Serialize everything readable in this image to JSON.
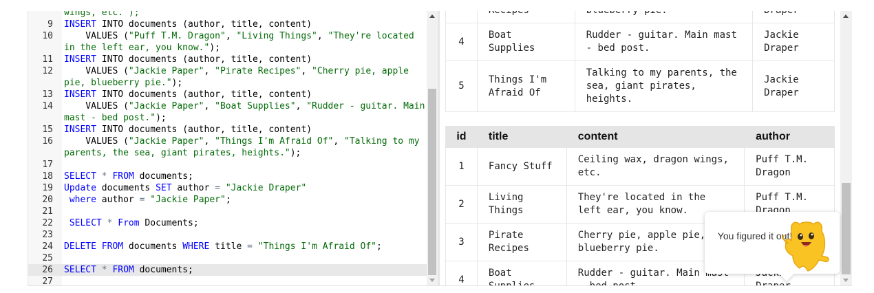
{
  "editor": {
    "lines": [
      {
        "num": "",
        "tokens": [
          {
            "t": "wings, etc.\");",
            "c": "str"
          }
        ]
      },
      {
        "num": "9",
        "tokens": [
          {
            "t": "INSERT",
            "c": "kw"
          },
          {
            "t": " INTO documents (author, title, content)"
          }
        ]
      },
      {
        "num": "10",
        "tokens": [
          {
            "t": "    VALUES ("
          },
          {
            "t": "\"Puff T.M. Dragon\"",
            "c": "str"
          },
          {
            "t": ", "
          },
          {
            "t": "\"Living Things\"",
            "c": "str"
          },
          {
            "t": ", "
          },
          {
            "t": "\"They're located",
            "c": "str"
          }
        ]
      },
      {
        "num": "",
        "tokens": [
          {
            "t": "in the left ear, you know.\"",
            "c": "str"
          },
          {
            "t": ");"
          }
        ]
      },
      {
        "num": "11",
        "tokens": [
          {
            "t": "INSERT",
            "c": "kw"
          },
          {
            "t": " INTO documents (author, title, content)"
          }
        ]
      },
      {
        "num": "12",
        "tokens": [
          {
            "t": "    VALUES ("
          },
          {
            "t": "\"Jackie Paper\"",
            "c": "str"
          },
          {
            "t": ", "
          },
          {
            "t": "\"Pirate Recipes\"",
            "c": "str"
          },
          {
            "t": ", "
          },
          {
            "t": "\"Cherry pie, apple",
            "c": "str"
          }
        ]
      },
      {
        "num": "",
        "tokens": [
          {
            "t": "pie, blueberry pie.\"",
            "c": "str"
          },
          {
            "t": ");"
          }
        ]
      },
      {
        "num": "13",
        "tokens": [
          {
            "t": "INSERT",
            "c": "kw"
          },
          {
            "t": " INTO documents (author, title, content)"
          }
        ]
      },
      {
        "num": "14",
        "tokens": [
          {
            "t": "    VALUES ("
          },
          {
            "t": "\"Jackie Paper\"",
            "c": "str"
          },
          {
            "t": ", "
          },
          {
            "t": "\"Boat Supplies\"",
            "c": "str"
          },
          {
            "t": ", "
          },
          {
            "t": "\"Rudder - guitar. Main",
            "c": "str"
          }
        ]
      },
      {
        "num": "",
        "tokens": [
          {
            "t": "mast - bed post.\"",
            "c": "str"
          },
          {
            "t": ");"
          }
        ]
      },
      {
        "num": "15",
        "tokens": [
          {
            "t": "INSERT",
            "c": "kw"
          },
          {
            "t": " INTO documents (author, title, content)"
          }
        ]
      },
      {
        "num": "16",
        "tokens": [
          {
            "t": "    VALUES ("
          },
          {
            "t": "\"Jackie Paper\"",
            "c": "str"
          },
          {
            "t": ", "
          },
          {
            "t": "\"Things I'm Afraid Of\"",
            "c": "str"
          },
          {
            "t": ", "
          },
          {
            "t": "\"Talking to my",
            "c": "str"
          }
        ]
      },
      {
        "num": "",
        "tokens": [
          {
            "t": "parents, the sea, giant pirates, heights.\"",
            "c": "str"
          },
          {
            "t": ");"
          }
        ]
      },
      {
        "num": "17",
        "tokens": []
      },
      {
        "num": "18",
        "tokens": [
          {
            "t": "SELECT",
            "c": "kw"
          },
          {
            "t": " "
          },
          {
            "t": "*",
            "c": "op"
          },
          {
            "t": " "
          },
          {
            "t": "FROM",
            "c": "kw"
          },
          {
            "t": " documents;"
          }
        ]
      },
      {
        "num": "19",
        "tokens": [
          {
            "t": "Update",
            "c": "kw"
          },
          {
            "t": " documents "
          },
          {
            "t": "SET",
            "c": "kw"
          },
          {
            "t": " author "
          },
          {
            "t": "=",
            "c": "op"
          },
          {
            "t": " "
          },
          {
            "t": "\"Jackie Draper\"",
            "c": "str"
          }
        ]
      },
      {
        "num": "20",
        "tokens": [
          {
            "t": " "
          },
          {
            "t": "where",
            "c": "kw"
          },
          {
            "t": " author "
          },
          {
            "t": "=",
            "c": "op"
          },
          {
            "t": " "
          },
          {
            "t": "\"Jackie Paper\"",
            "c": "str"
          },
          {
            "t": ";"
          }
        ]
      },
      {
        "num": "21",
        "tokens": []
      },
      {
        "num": "22",
        "tokens": [
          {
            "t": " "
          },
          {
            "t": "SELECT",
            "c": "kw"
          },
          {
            "t": " "
          },
          {
            "t": "*",
            "c": "op"
          },
          {
            "t": " "
          },
          {
            "t": "From",
            "c": "kw"
          },
          {
            "t": " Documents;"
          }
        ]
      },
      {
        "num": "23",
        "tokens": []
      },
      {
        "num": "24",
        "tokens": [
          {
            "t": "DELETE",
            "c": "kw"
          },
          {
            "t": " "
          },
          {
            "t": "FROM",
            "c": "kw"
          },
          {
            "t": " documents "
          },
          {
            "t": "WHERE",
            "c": "kw"
          },
          {
            "t": " title "
          },
          {
            "t": "=",
            "c": "op"
          },
          {
            "t": " "
          },
          {
            "t": "\"Things I'm Afraid Of\"",
            "c": "str"
          },
          {
            "t": ";"
          }
        ]
      },
      {
        "num": "25",
        "tokens": []
      },
      {
        "num": "26",
        "active": true,
        "tokens": [
          {
            "t": "SELECT",
            "c": "kw"
          },
          {
            "t": " "
          },
          {
            "t": "*",
            "c": "op"
          },
          {
            "t": " "
          },
          {
            "t": "FROM",
            "c": "kw"
          },
          {
            "t": " documents;"
          }
        ]
      },
      {
        "num": "27",
        "tokens": []
      }
    ]
  },
  "results": {
    "table1": {
      "rows": [
        {
          "id": "",
          "title": "Recipes",
          "content": "blueberry pie.",
          "author": "Draper"
        },
        {
          "id": "4",
          "title": "Boat Supplies",
          "content": "Rudder - guitar. Main mast - bed post.",
          "author": "Jackie Draper"
        },
        {
          "id": "5",
          "title": "Things I'm Afraid Of",
          "content": "Talking to my parents, the sea, giant pirates, heights.",
          "author": "Jackie Draper"
        }
      ]
    },
    "table2": {
      "headers": {
        "id": "id",
        "title": "title",
        "content": "content",
        "author": "author"
      },
      "rows": [
        {
          "id": "1",
          "title": "Fancy Stuff",
          "content": "Ceiling wax, dragon wings, etc.",
          "author": "Puff T.M. Dragon"
        },
        {
          "id": "2",
          "title": "Living Things",
          "content": "They're located in the left ear, you know.",
          "author": "Puff T.M. Dragon"
        },
        {
          "id": "3",
          "title": "Pirate Recipes",
          "content": "Cherry pie, apple pie, blueberry pie.",
          "author": "Jackie Draper"
        },
        {
          "id": "4",
          "title": "Boat Supplies",
          "content": "Rudder - guitar. Main mast - bed post.",
          "author": "Jackie Draper"
        }
      ]
    }
  },
  "toast": {
    "message": "You figured it out!",
    "mascot_icon": "winston-mascot-icon",
    "mascot_color": "#f9c323"
  }
}
